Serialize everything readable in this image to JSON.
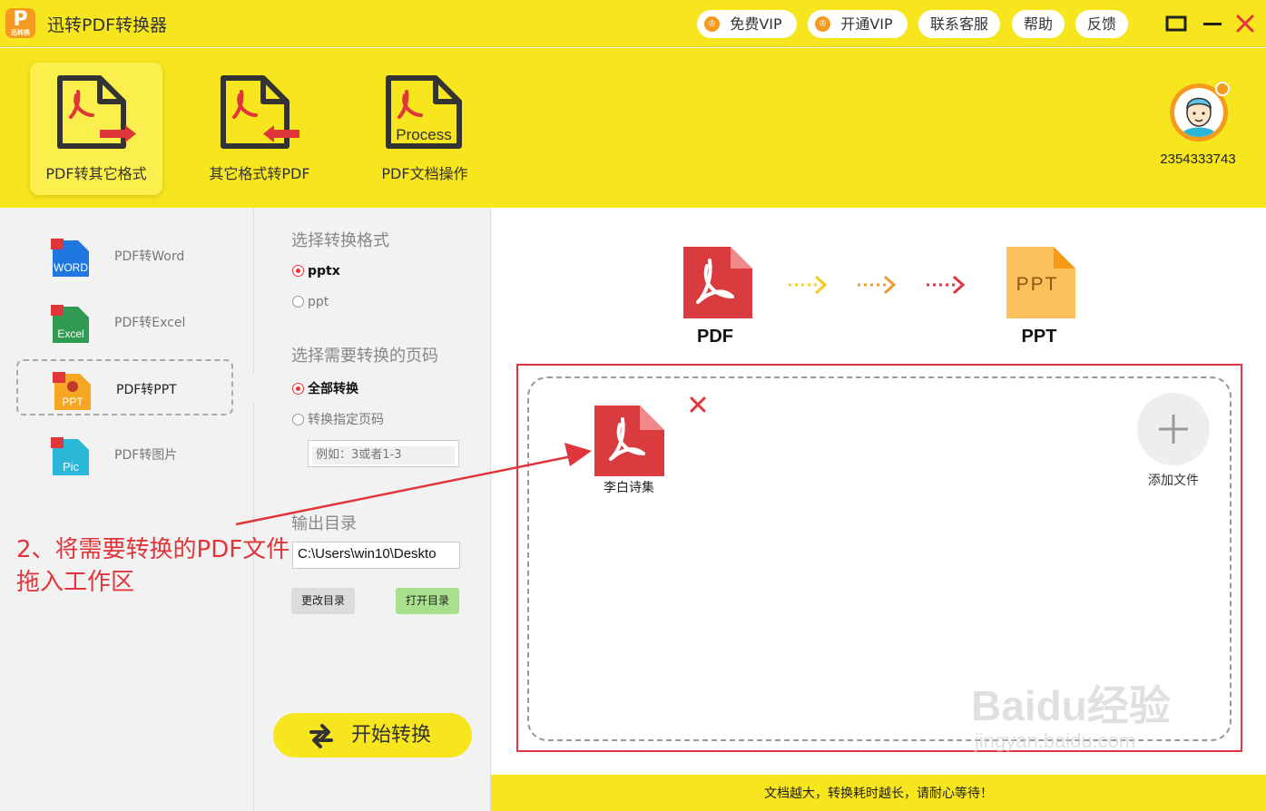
{
  "titlebar": {
    "app_title": "迅转PDF转换器",
    "logo_text": "P",
    "logo_sub": "迅转换",
    "buttons": {
      "free_vip": "免费VIP",
      "open_vip": "开通VIP",
      "support": "联系客服",
      "help": "帮助",
      "feedback": "反馈"
    }
  },
  "toolbar": {
    "tools": [
      {
        "label": "PDF转其它格式",
        "active": true
      },
      {
        "label": "其它格式转PDF",
        "active": false
      },
      {
        "label": "PDF文档操作",
        "active": false,
        "icon_text": "Process"
      }
    ],
    "user_id": "2354333743"
  },
  "sidebar": {
    "items": [
      {
        "label": "PDF转Word",
        "icon_text": "WORD"
      },
      {
        "label": "PDF转Excel",
        "icon_text": "Excel"
      },
      {
        "label": "PDF转PPT",
        "icon_text": "PPT",
        "active": true
      },
      {
        "label": "PDF转图片",
        "icon_text": "Pic"
      }
    ]
  },
  "options": {
    "format_heading": "选择转换格式",
    "formats": [
      "pptx",
      "ppt"
    ],
    "selected_format": "pptx",
    "pages_heading": "选择需要转换的页码",
    "page_modes": [
      "全部转换",
      "转换指定页码"
    ],
    "selected_page_mode": "全部转换",
    "page_placeholder": "例如：3或者1-3",
    "output_heading": "输出目录",
    "output_path": "C:\\Users\\win10\\Deskto",
    "change_dir": "更改目录",
    "open_dir": "打开目录",
    "start": "开始转换"
  },
  "main": {
    "from_label": "PDF",
    "to_label": "PPT",
    "ppt_icon_text": "PPT",
    "file_name": "李白诗集",
    "add_file": "添加文件",
    "status": "文档越大，转换耗时越长，请耐心等待！"
  },
  "annotation": {
    "line1": "2、将需要转换的PDF文件",
    "line2": "拖入工作区"
  },
  "watermark": {
    "brand": "Baidu经验",
    "url": "jingyan.baidu.com"
  },
  "colors": {
    "brand_yellow": "#f7e51e",
    "accent_red": "#e0353a",
    "orange": "#f39a1f",
    "pdf_red": "#d93b3f",
    "ppt_orange": "#fbbf5c"
  }
}
